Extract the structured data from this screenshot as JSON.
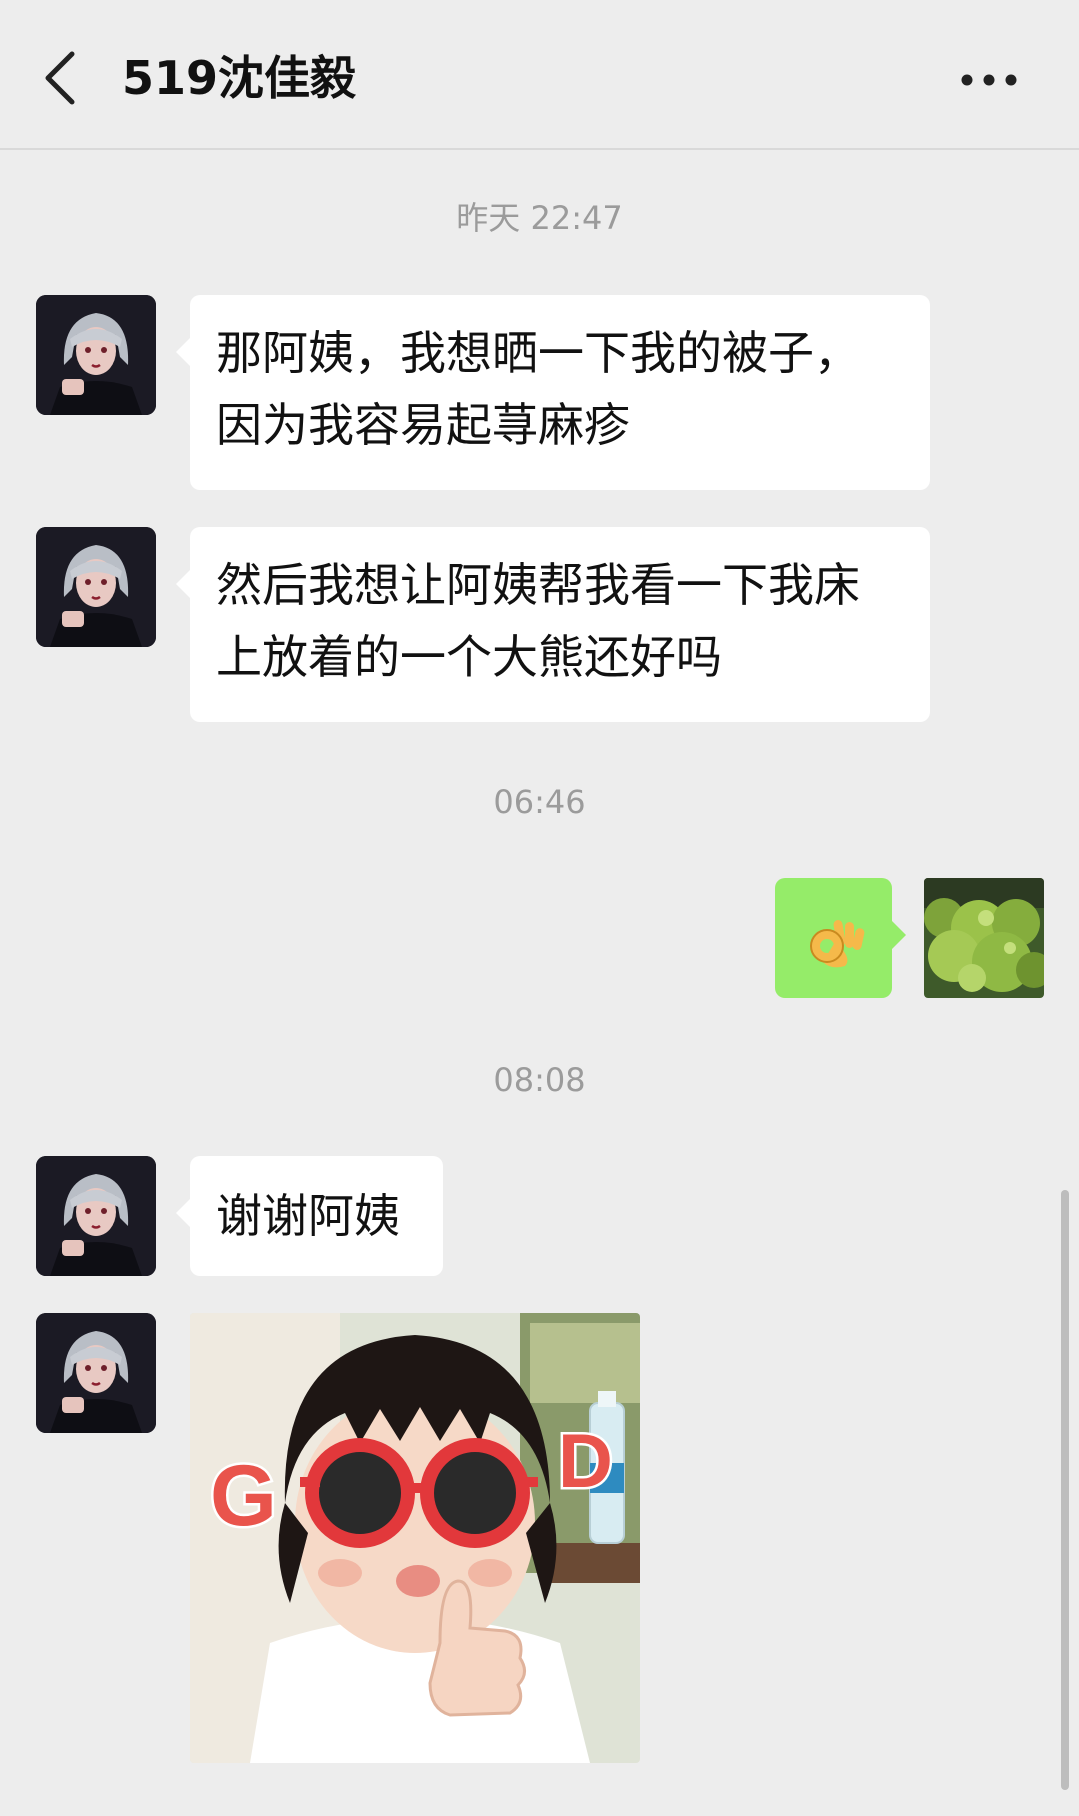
{
  "header": {
    "title": "519沈佳毅",
    "back_icon": "chevron-left-icon",
    "more_icon": "more-dots-icon"
  },
  "timestamps": [
    "昨天 22:47",
    "06:46",
    "08:08"
  ],
  "messages": [
    {
      "side": "left",
      "text": "那阿姨，我想晒一下我的被子，因为我容易起荨麻疹"
    },
    {
      "side": "left",
      "text": "然后我想让阿姨帮我看一下我床上放着的一个大熊还好吗"
    },
    {
      "side": "right",
      "type": "emoji",
      "emoji": "👌"
    },
    {
      "side": "left",
      "text": "谢谢阿姨"
    },
    {
      "side": "left",
      "type": "sticker",
      "sticker_text_left": "G",
      "sticker_text_right": "D"
    }
  ],
  "colors": {
    "background": "#ededed",
    "bubble_in": "#ffffff",
    "bubble_out": "#95ec69",
    "timestamp": "#9b9b9b"
  }
}
